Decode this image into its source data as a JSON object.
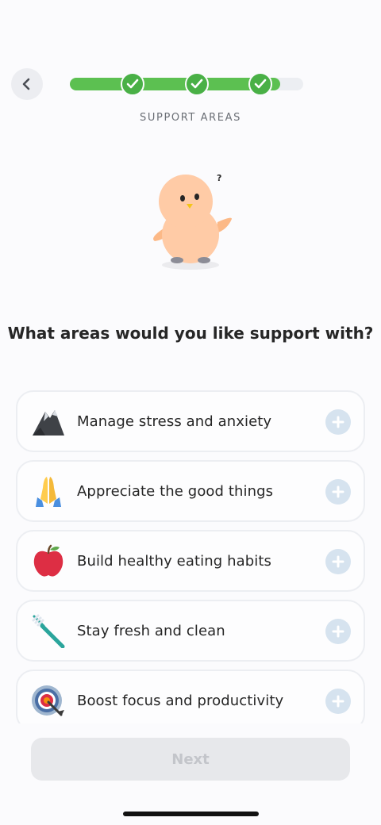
{
  "header": {
    "back_icon": "chevron-left-icon",
    "progress": {
      "completed_steps": 3,
      "total_steps": 4,
      "fill_fraction": 0.9
    },
    "step_title": "SUPPORT AREAS"
  },
  "mascot": {
    "thought": "?"
  },
  "question": "What areas would you like support with?",
  "options": [
    {
      "label": "Manage stress and anxiety",
      "icon": "mountain-icon"
    },
    {
      "label": "Appreciate the good things",
      "icon": "folded-hands-icon"
    },
    {
      "label": "Build healthy eating habits",
      "icon": "apple-icon"
    },
    {
      "label": "Stay fresh and clean",
      "icon": "toothbrush-icon"
    },
    {
      "label": "Boost focus and productivity",
      "icon": "bullseye-icon"
    }
  ],
  "next_label": "Next",
  "colors": {
    "accent": "#5cc051",
    "check": "#49b046",
    "add": "#d6e3ef"
  }
}
